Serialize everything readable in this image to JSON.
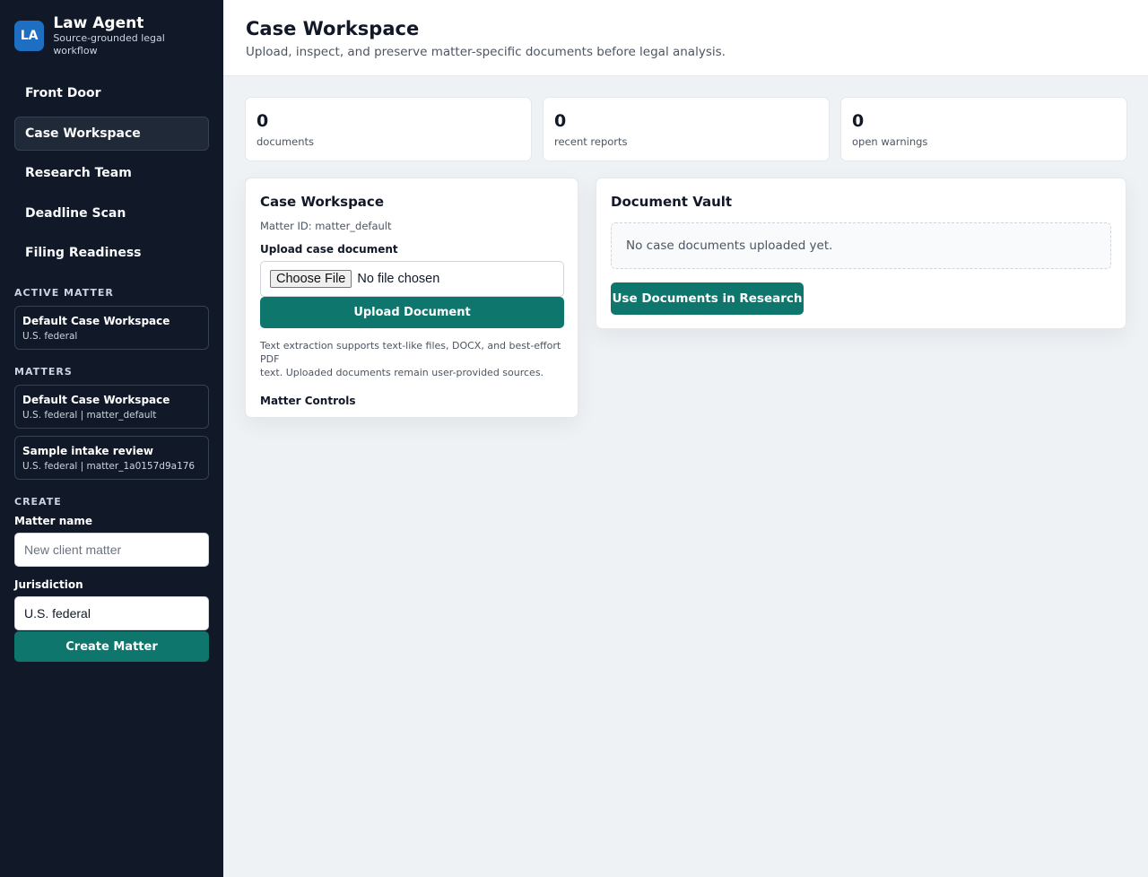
{
  "brand": {
    "logo": "LA",
    "title": "Law Agent",
    "subtitle": "Source-grounded legal workflow"
  },
  "nav": [
    {
      "label": "Front Door",
      "active": false
    },
    {
      "label": "Case Workspace",
      "active": true
    },
    {
      "label": "Research Team",
      "active": false
    },
    {
      "label": "Deadline Scan",
      "active": false
    },
    {
      "label": "Filing Readiness",
      "active": false
    }
  ],
  "active_matter": {
    "section": "ACTIVE MATTER",
    "name": "Default Case Workspace",
    "meta": "U.S. federal"
  },
  "matters": {
    "section": "MATTERS",
    "items": [
      {
        "name": "Default Case Workspace",
        "meta": "U.S. federal | matter_default"
      },
      {
        "name": "Sample intake review",
        "meta": "U.S. federal | matter_1a0157d9a176"
      }
    ]
  },
  "create": {
    "section": "CREATE",
    "name_label": "Matter name",
    "name_placeholder": "New client matter",
    "jurisdiction_label": "Jurisdiction",
    "jurisdiction_value": "U.S. federal",
    "button": "Create Matter"
  },
  "header": {
    "title": "Case Workspace",
    "subtitle": "Upload, inspect, and preserve matter-specific documents before legal analysis."
  },
  "stats": [
    {
      "value": "0",
      "label": "documents"
    },
    {
      "value": "0",
      "label": "recent reports"
    },
    {
      "value": "0",
      "label": "open warnings"
    }
  ],
  "workspace": {
    "title": "Case Workspace",
    "matter_id": "Matter ID: matter_default",
    "upload_label": "Upload case document",
    "choose_file": "Choose File",
    "no_file": "No file chosen",
    "upload_button": "Upload Document",
    "help_line1": "Text extraction supports text-like files, DOCX, and best-effort PDF",
    "help_line2": "text. Uploaded documents remain user-provided sources.",
    "controls": "Matter Controls"
  },
  "vault": {
    "title": "Document Vault",
    "empty": "No case documents uploaded yet.",
    "button": "Use Documents in Research"
  },
  "colors": {
    "sidebar": "#111827",
    "accent": "#0f766e",
    "logo": "#1e6fc1",
    "background": "#eef2f5"
  }
}
